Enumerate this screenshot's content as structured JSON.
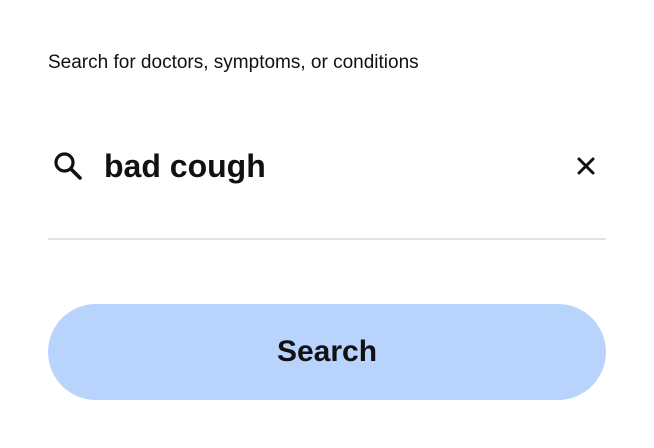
{
  "prompt": {
    "label": "Search for doctors, symptoms, or conditions"
  },
  "search": {
    "value": "bad cough",
    "icon": "search-icon",
    "clear_icon": "close-icon"
  },
  "actions": {
    "search_label": "Search"
  },
  "colors": {
    "button_background": "#b8d4fc",
    "divider": "#e2e2e2",
    "text": "#111111"
  }
}
